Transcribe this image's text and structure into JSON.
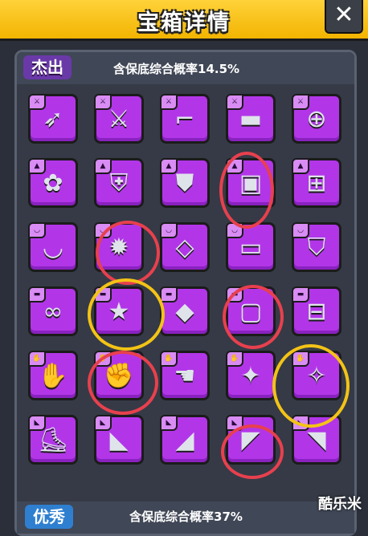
{
  "header": {
    "title": "宝箱详情",
    "close_label": "✕"
  },
  "section": {
    "tier_label": "杰出",
    "rate_text": "含保底综合概率14.5%"
  },
  "bottom_section": {
    "tier_label": "优秀",
    "rate_text": "含保底综合概率37%"
  },
  "watermark": "酷乐米",
  "rows": [
    {
      "category": "weapon",
      "badge_icon": "weapon-badge-icon",
      "items": [
        "kunai-icon",
        "scimitar-icon",
        "revolver-icon",
        "shotgun-icon",
        "plunger-icon"
      ]
    },
    {
      "category": "armor",
      "badge_icon": "shirt-badge-icon",
      "items": [
        "leaf-armor-icon",
        "steel-armor-icon",
        "plated-armor-icon",
        "chest-plate-icon",
        "tech-vest-icon"
      ]
    },
    {
      "category": "necklace",
      "badge_icon": "necklace-badge-icon",
      "items": [
        "fang-collar-icon",
        "spiked-collar-icon",
        "gem-necklace-icon",
        "tag-necklace-icon",
        "shield-collar-icon"
      ]
    },
    {
      "category": "belt",
      "badge_icon": "belt-badge-icon",
      "items": [
        "knotted-belt-icon",
        "star-belt-icon",
        "gem-belt-icon",
        "buckle-belt-icon",
        "tech-belt-icon"
      ]
    },
    {
      "category": "gloves",
      "badge_icon": "glove-badge-icon",
      "items": [
        "fur-claw-icon",
        "steel-gauntlet-icon",
        "mech-glove-icon",
        "spark-glove-icon",
        "blade-gauntlet-icon"
      ]
    },
    {
      "category": "boots",
      "badge_icon": "boot-badge-icon",
      "items": [
        "claw-boot-icon",
        "sneaker-icon",
        "plated-boot-icon",
        "purple-sneaker-icon",
        "mech-boot-icon"
      ]
    }
  ],
  "colors": {
    "header": "#f2b400",
    "slot": "#b236e8",
    "panel": "#353a46",
    "red_mark": "#e8404e",
    "yellow_mark": "#f3c316"
  }
}
